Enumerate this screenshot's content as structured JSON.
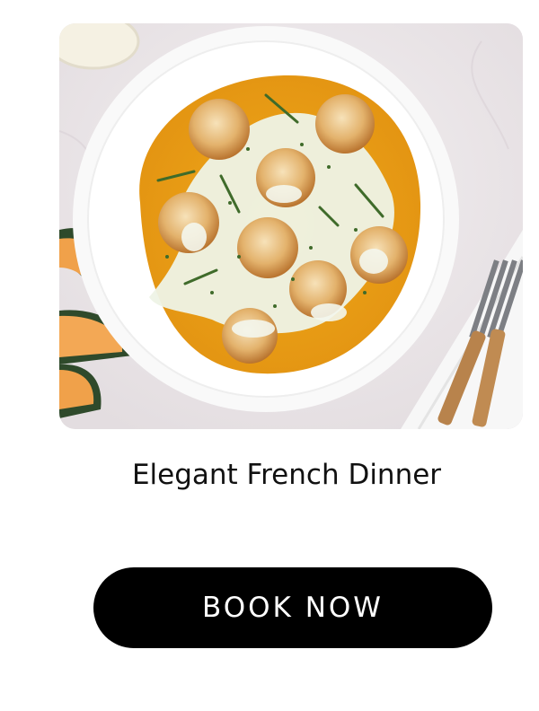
{
  "card": {
    "image_alt": "Seared scallops on butternut squash purée with herb cream sauce",
    "title": "Elegant French Dinner",
    "cta_label": "BOOK NOW"
  },
  "colors": {
    "button_bg": "#000000",
    "button_text": "#ffffff",
    "title_text": "#111111"
  }
}
